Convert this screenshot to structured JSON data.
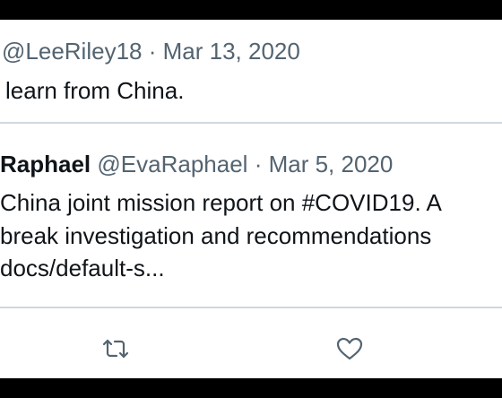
{
  "tweet": {
    "handle": "@LeeRiley18",
    "separator": "·",
    "date": "Mar 13, 2020",
    "text": "learn from China."
  },
  "quoted_tweet": {
    "name": "Raphael",
    "handle": "@EvaRaphael",
    "separator": "·",
    "date": "Mar 5, 2020",
    "text_line_1": "China joint mission report on #COVID19. A",
    "text_line_2": "break investigation and recommendations",
    "text_line_3": "docs/default-s..."
  },
  "actions": {
    "retweet_icon": "retweet-icon",
    "like_icon": "heart-icon"
  },
  "colors": {
    "text": "#0f1419",
    "muted": "#536471",
    "divider": "#cfd9de",
    "background": "#ffffff",
    "frame": "#000000"
  }
}
